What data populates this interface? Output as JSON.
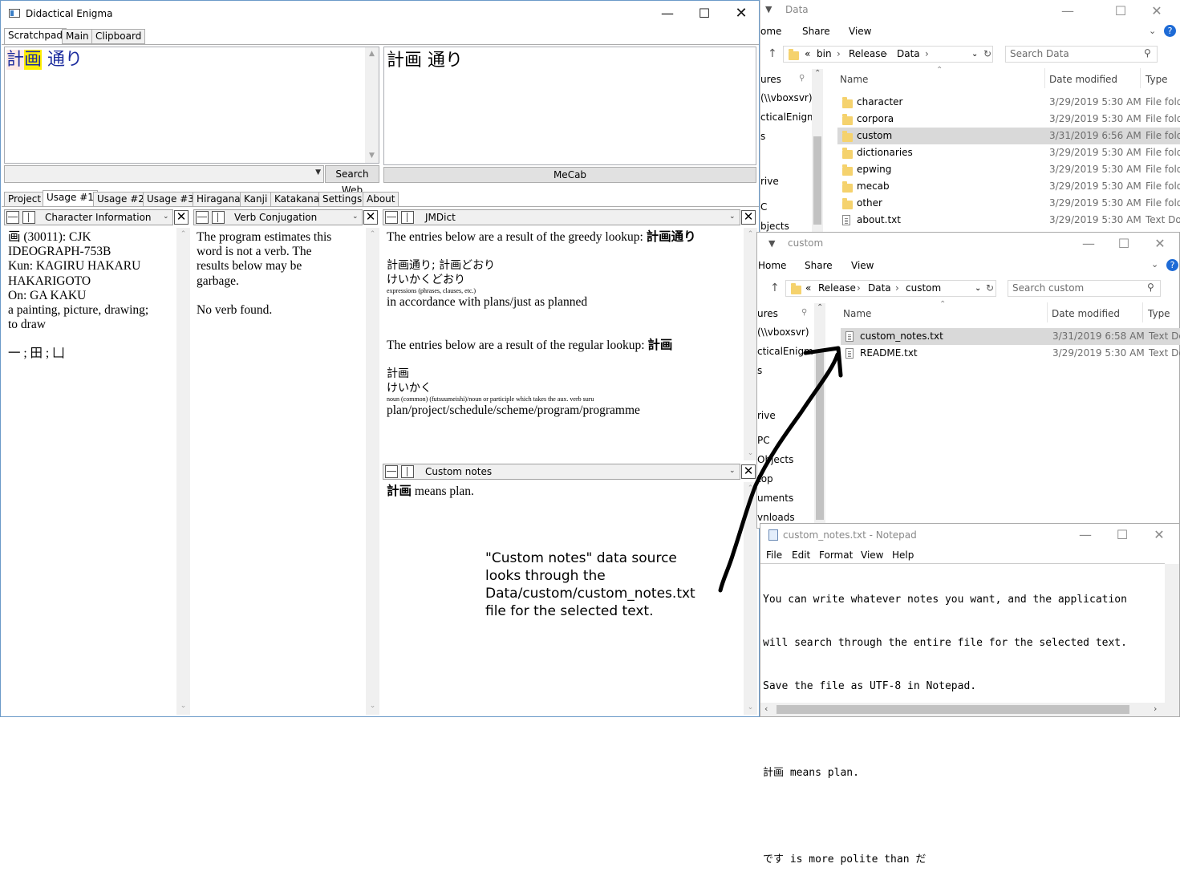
{
  "main_window": {
    "title": "Didactical Enigma",
    "top_tabs": [
      "Scratchpad",
      "Main",
      "Clipboard"
    ],
    "input_text": [
      "計",
      "画",
      " 通り"
    ],
    "output_text": "計画 通り",
    "search_web_button": "Search Web",
    "mecab_button": "MeCab",
    "bottom_tabs": [
      "Project",
      "Usage #1",
      "Usage #2",
      "Usage #3",
      "Hiragana",
      "Kanji",
      "Katakana",
      "Settings",
      "About"
    ],
    "panels": {
      "char_info": {
        "header": "Character Information",
        "lines": [
          "画 (30011): CJK",
          "IDEOGRAPH-753B",
          "Kun: KAGIRU HAKARU",
          "HAKARIGOTO",
          "On: GA KAKU",
          "a painting, picture, drawing;",
          "to draw",
          "",
          "一 ; 田 ; 凵"
        ]
      },
      "verb_conj": {
        "header": "Verb Conjugation",
        "lines": [
          "The program estimates this",
          "word is not a verb. The",
          "results below may be",
          "garbage.",
          "",
          "No verb found."
        ]
      },
      "jmdict": {
        "header": "JMDict",
        "greedy_prefix": "The entries below are a result of the greedy lookup: ",
        "greedy_word": "計画通り",
        "entry1_headword": "計画通り; 計画どおり",
        "entry1_reading": "けいかくどおり",
        "entry1_pos": "expressions (phrases, clauses, etc.)",
        "entry1_gloss": "in accordance with plans/just as planned",
        "regular_prefix": "The entries below are a result of the regular lookup: ",
        "regular_word": "計画",
        "entry2_headword": "計画",
        "entry2_reading": "けいかく",
        "entry2_pos": "noun (common) (futsuumeishi)/noun or participle which takes the aux. verb suru",
        "entry2_gloss": "plan/project/schedule/scheme/program/programme"
      },
      "custom_notes": {
        "header": "Custom notes",
        "word": "計画",
        "rest": " means plan."
      }
    }
  },
  "annotation": {
    "lines": [
      "\"Custom notes\" data source",
      "looks through the",
      "Data/custom/custom_notes.txt",
      "file for the selected text."
    ]
  },
  "explorer_data": {
    "title": "Data",
    "ribbon": [
      "ome",
      "Share",
      "View"
    ],
    "breadcrumb": [
      "«",
      "bin",
      "Release",
      "Data"
    ],
    "search_placeholder": "Search Data",
    "columns": {
      "name": "Name",
      "date": "Date modified",
      "type": "Type"
    },
    "nav_items": [
      "ures",
      "(\\\\vboxsvr)",
      "cticalEnigm",
      "s",
      "rive",
      "C",
      "bjects"
    ],
    "files": [
      {
        "name": "character",
        "date": "3/29/2019 5:30 AM",
        "type": "File fold",
        "kind": "folder"
      },
      {
        "name": "corpora",
        "date": "3/29/2019 5:30 AM",
        "type": "File fold",
        "kind": "folder"
      },
      {
        "name": "custom",
        "date": "3/31/2019 6:56 AM",
        "type": "File fold",
        "kind": "folder"
      },
      {
        "name": "dictionaries",
        "date": "3/29/2019 5:30 AM",
        "type": "File fold",
        "kind": "folder"
      },
      {
        "name": "epwing",
        "date": "3/29/2019 5:30 AM",
        "type": "File fold",
        "kind": "folder"
      },
      {
        "name": "mecab",
        "date": "3/29/2019 5:30 AM",
        "type": "File fold",
        "kind": "folder"
      },
      {
        "name": "other",
        "date": "3/29/2019 5:30 AM",
        "type": "File fold",
        "kind": "folder"
      },
      {
        "name": "about.txt",
        "date": "3/29/2019 5:30 AM",
        "type": "Text Doc",
        "kind": "file"
      }
    ]
  },
  "explorer_custom": {
    "title": "custom",
    "ribbon": [
      "Home",
      "Share",
      "View"
    ],
    "breadcrumb": [
      "«",
      "Release",
      "Data",
      "custom"
    ],
    "search_placeholder": "Search custom",
    "columns": {
      "name": "Name",
      "date": "Date modified",
      "type": "Type"
    },
    "nav_items": [
      "ures",
      "(\\\\vboxsvr)",
      "cticalEnigm",
      "s",
      "rive",
      "PC",
      "Objects",
      "top",
      "uments",
      "vnloads"
    ],
    "files": [
      {
        "name": "custom_notes.txt",
        "date": "3/31/2019 6:58 AM",
        "type": "Text Do",
        "kind": "file"
      },
      {
        "name": "README.txt",
        "date": "3/29/2019 5:30 AM",
        "type": "Text Do",
        "kind": "file"
      }
    ]
  },
  "notepad": {
    "title": "custom_notes.txt - Notepad",
    "menu": [
      "File",
      "Edit",
      "Format",
      "View",
      "Help"
    ],
    "lines": [
      "You can write whatever notes you want, and the application",
      "will search through the entire file for the selected text.",
      "Save the file as UTF-8 in Notepad.",
      "",
      "計画 means plan.",
      "",
      "です is more polite than だ"
    ]
  }
}
